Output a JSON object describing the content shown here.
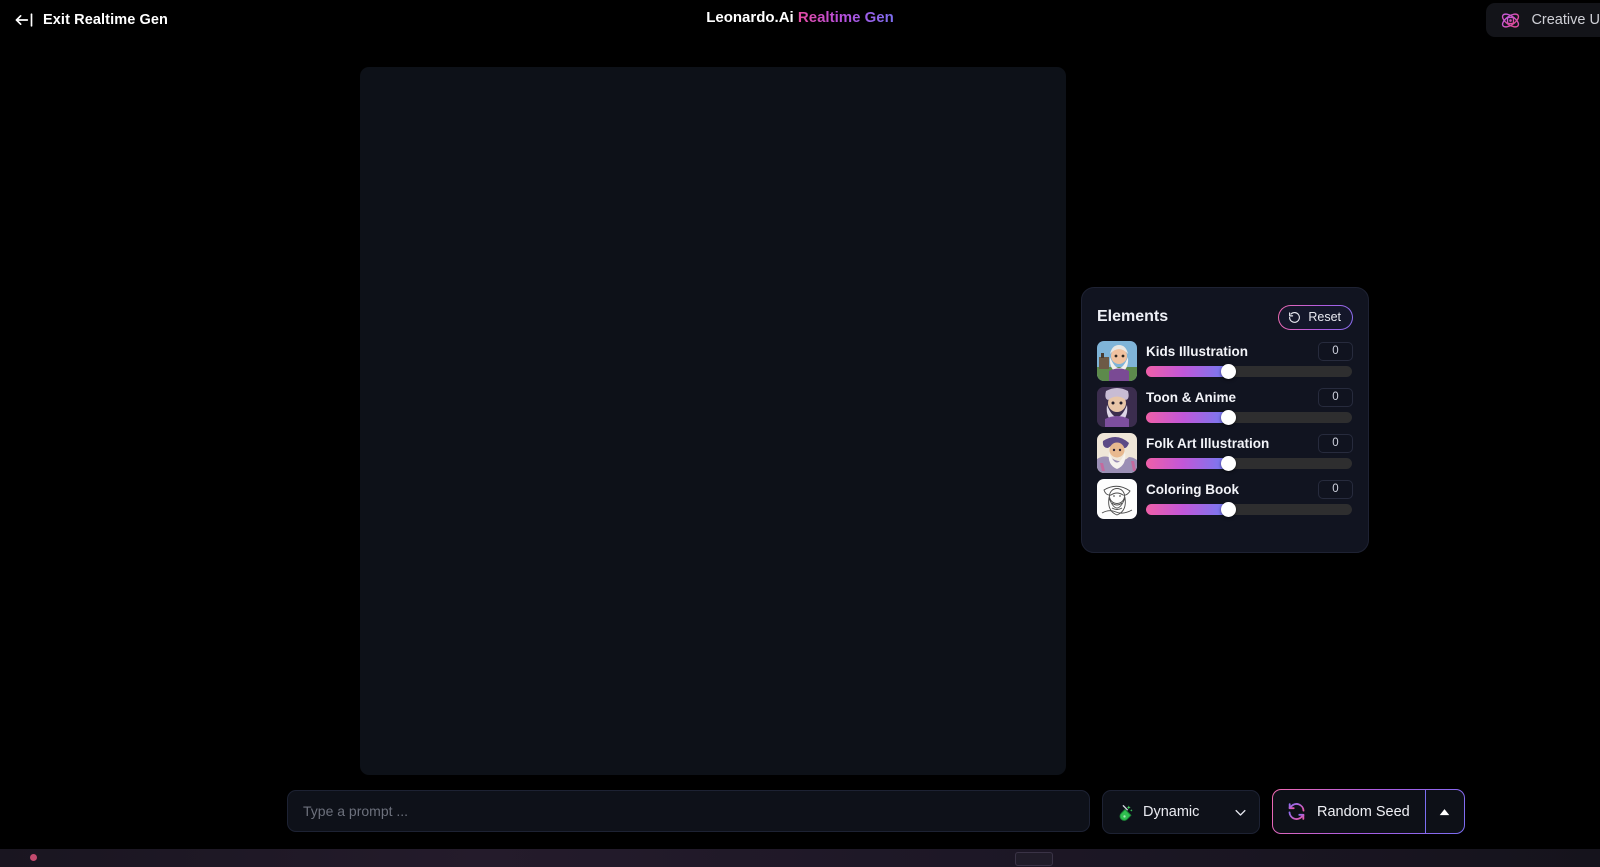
{
  "topbar": {
    "exit_label": "Exit Realtime Gen",
    "exit_icon": "arrow-left-to-line-icon",
    "title_brand": "Leonardo.Ai",
    "title_mode": "Realtime Gen",
    "creative_label": "Creative Up",
    "creative_icon": "atom-icon"
  },
  "panel": {
    "title": "Elements",
    "reset_label": "Reset",
    "reset_icon": "rotate-ccw-icon",
    "items": [
      {
        "name": "Kids Illustration",
        "value": "0",
        "fill_pct": 40,
        "thumb": "wizard-kids-illustration-thumb"
      },
      {
        "name": "Toon & Anime",
        "value": "0",
        "fill_pct": 40,
        "thumb": "wizard-toon-anime-thumb"
      },
      {
        "name": "Folk Art Illustration",
        "value": "0",
        "fill_pct": 40,
        "thumb": "wizard-folk-art-thumb"
      },
      {
        "name": "Coloring Book",
        "value": "0",
        "fill_pct": 40,
        "thumb": "wizard-coloring-book-thumb"
      }
    ]
  },
  "bottom": {
    "prompt_placeholder": "Type a prompt ...",
    "prompt_value": "",
    "mode_label": "Dynamic",
    "mode_icon": "potion-flask-icon",
    "mode_chevron": "chevron-down-icon",
    "seed_label": "Random Seed",
    "seed_icon": "refresh-circular-icon",
    "seed_caret": "caret-up-icon"
  },
  "colors": {
    "accent_pink": "#ef5fa8",
    "accent_purple": "#b15be0",
    "accent_blue": "#6f7cf2",
    "panel_bg": "#111420",
    "canvas_bg": "#0d1118",
    "page_bg": "#000000"
  }
}
